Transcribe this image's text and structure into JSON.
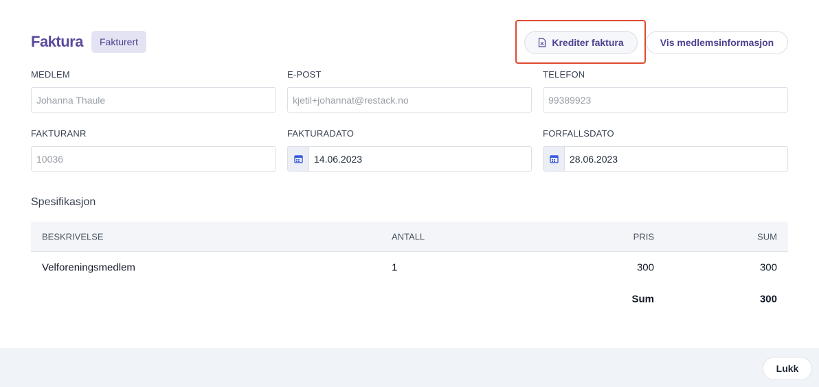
{
  "header": {
    "title": "Faktura",
    "status_badge": "Fakturert"
  },
  "actions": {
    "credit_label": "Krediter faktura",
    "credit_icon": "file-x-icon",
    "member_info_label": "Vis medlemsinformasjon"
  },
  "fields": {
    "member": {
      "label": "MEDLEM",
      "value": "Johanna Thaule"
    },
    "email": {
      "label": "E-POST",
      "value": "kjetil+johannat@restack.no"
    },
    "phone": {
      "label": "TELEFON",
      "value": "99389923"
    },
    "invoice_no": {
      "label": "FAKTURANR",
      "value": "10036"
    },
    "invoice_date": {
      "label": "FAKTURADATO",
      "value": "14.06.2023",
      "icon": "calendar-icon"
    },
    "due_date": {
      "label": "FORFALLSDATO",
      "value": "28.06.2023",
      "icon": "calendar-icon"
    }
  },
  "specification": {
    "title": "Spesifikasjon",
    "columns": {
      "description": "BESKRIVELSE",
      "quantity": "ANTALL",
      "price": "PRIS",
      "sum": "SUM"
    },
    "rows": [
      {
        "description": "Velforeningsmedlem",
        "quantity": "1",
        "price": "300",
        "sum": "300"
      }
    ],
    "total_label": "Sum",
    "total_value": "300"
  },
  "footer": {
    "close_label": "Lukk"
  },
  "colors": {
    "accent": "#5b4a9c",
    "highlight": "#e0492f",
    "calendar_icon": "#3b5bdb"
  }
}
